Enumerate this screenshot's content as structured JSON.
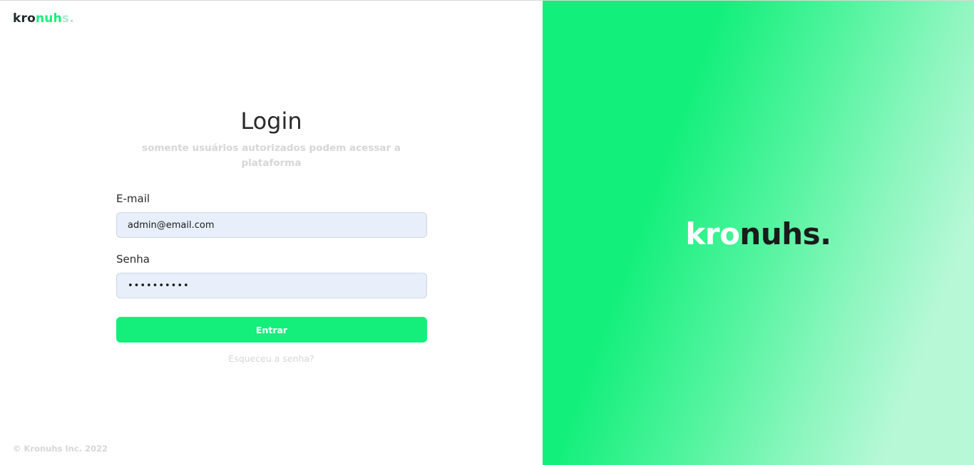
{
  "brand": {
    "logo_part1": "kro",
    "logo_part2": "nuh",
    "logo_part3": "s.",
    "hero_part1": "kro",
    "hero_part2": "nuhs.",
    "accent_color": "#14ef7b"
  },
  "login": {
    "title": "Login",
    "subtitle": "somente usuários autorizados podem acessar a plataforma",
    "email_label": "E-mail",
    "email_value": "admin@email.com",
    "password_label": "Senha",
    "password_value": "••••••••••",
    "submit_label": "Entrar",
    "forgot_link": "Esqueceu a senha?"
  },
  "footer": {
    "copyright": "© Kronuhs Inc. 2022"
  }
}
